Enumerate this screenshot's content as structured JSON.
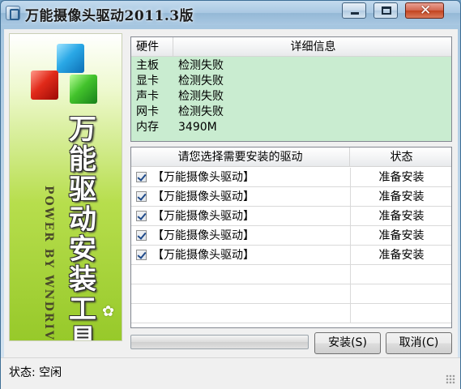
{
  "window": {
    "title": "万能摄像头驱动2011.3版"
  },
  "titlebar_buttons": {
    "minimize": "minimize",
    "maximize": "maximize",
    "close": "✕"
  },
  "banner": {
    "title": "万能驱动安装工具",
    "subtitle": "POWER BY WNDRIVERS",
    "logo": "✿"
  },
  "hardware": {
    "columns": [
      "硬件",
      "详细信息"
    ],
    "rows": [
      {
        "key": "主板",
        "value": "检测失败"
      },
      {
        "key": "显卡",
        "value": "检测失败"
      },
      {
        "key": "声卡",
        "value": "检测失败"
      },
      {
        "key": "网卡",
        "value": "检测失败"
      },
      {
        "key": "内存",
        "value": "3490M"
      }
    ]
  },
  "drivers": {
    "columns": [
      "请您选择需要安装的驱动",
      "状态"
    ],
    "rows": [
      {
        "checked": true,
        "name": "【万能摄像头驱动】",
        "status": "准备安装"
      },
      {
        "checked": true,
        "name": "【万能摄像头驱动】",
        "status": "准备安装"
      },
      {
        "checked": true,
        "name": "【万能摄像头驱动】",
        "status": "准备安装"
      },
      {
        "checked": true,
        "name": "【万能摄像头驱动】",
        "status": "准备安装"
      },
      {
        "checked": true,
        "name": "【万能摄像头驱动】",
        "status": "准备安装"
      }
    ]
  },
  "buttons": {
    "install": "安装(S)",
    "cancel": "取消(C)"
  },
  "progress": {
    "value": 0
  },
  "status": {
    "text": "状态: 空闲"
  }
}
